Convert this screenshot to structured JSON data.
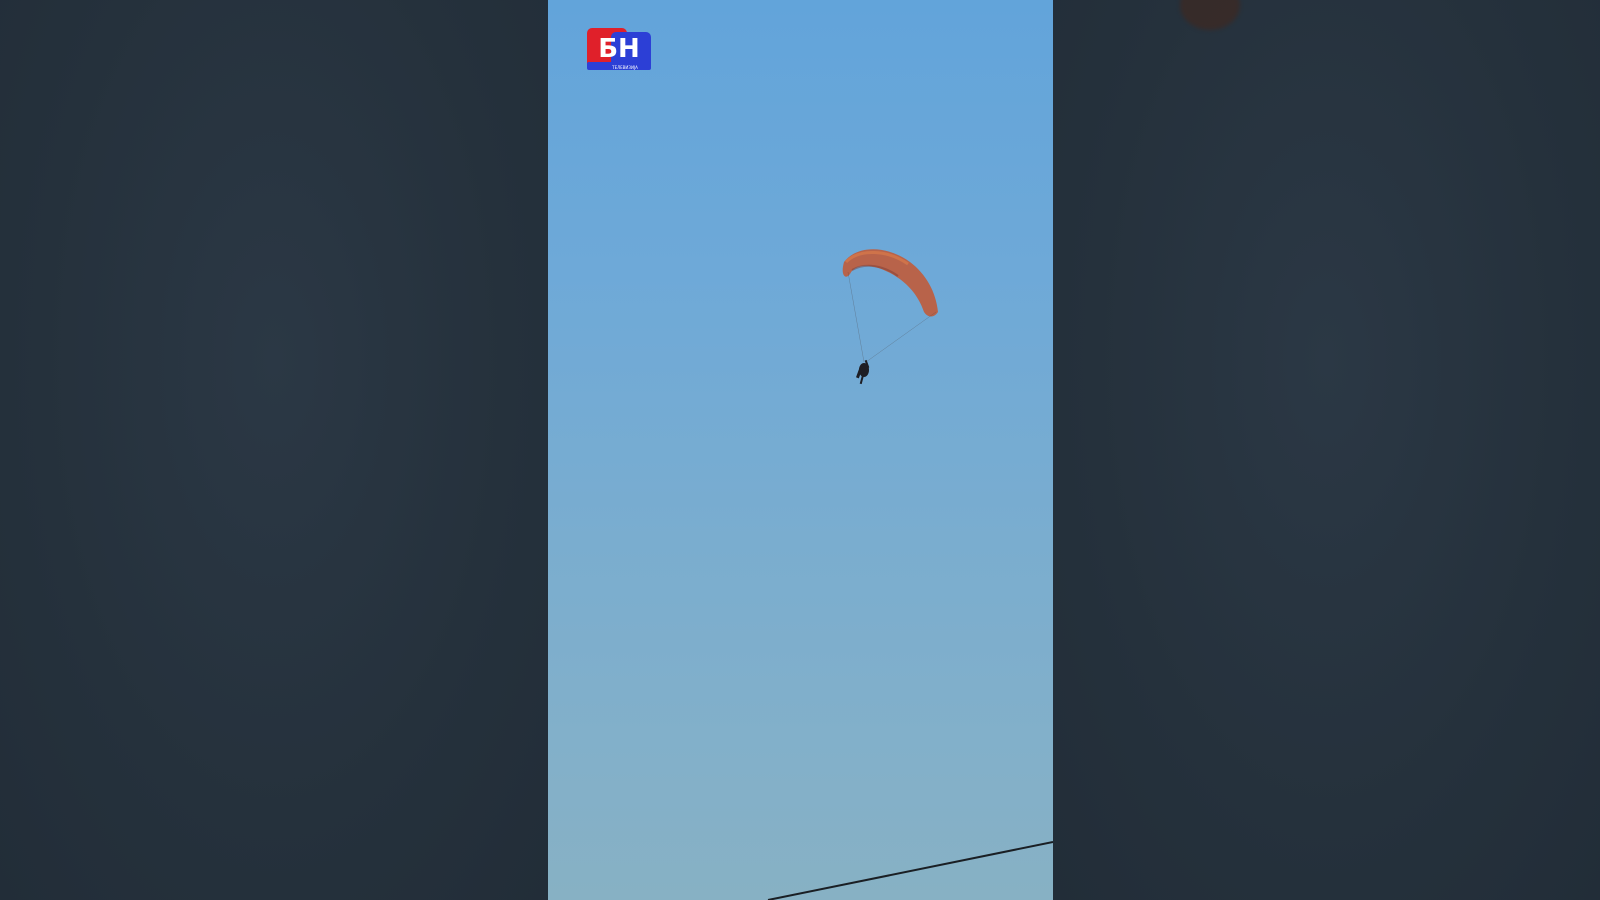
{
  "video": {
    "logo_text": "БН",
    "logo_subtext": "ТЕЛЕВИЗИЈА",
    "colors": {
      "logo_red": "#e0202a",
      "logo_blue": "#2c3fd6",
      "sky_top": "#62a4da",
      "sky_bottom": "#87b1c4",
      "canopy": "#b8634a",
      "backdrop": "#263340"
    }
  }
}
